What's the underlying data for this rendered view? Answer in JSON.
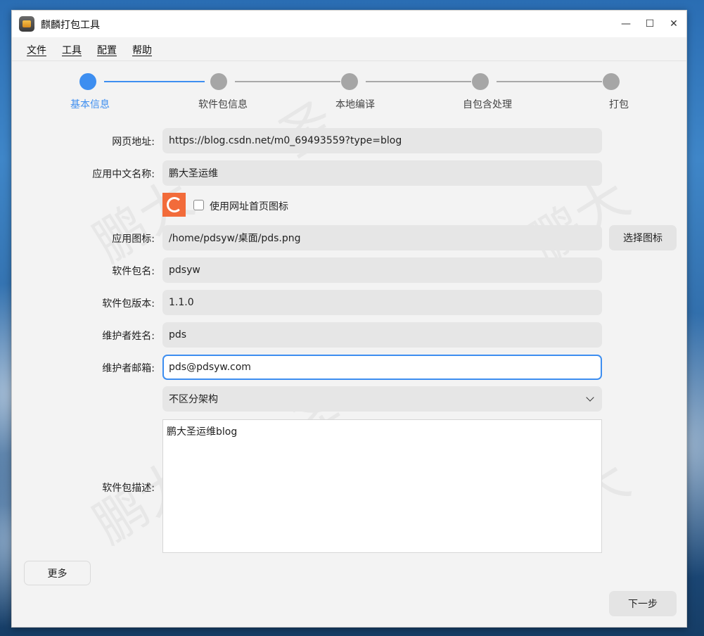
{
  "window": {
    "title": "麒麟打包工具",
    "minimize_glyph": "—",
    "maximize_glyph": "☐",
    "close_glyph": "✕"
  },
  "menu": [
    "文件",
    "工具",
    "配置",
    "帮助"
  ],
  "steps": [
    {
      "label": "基本信息",
      "active": true
    },
    {
      "label": "软件包信息",
      "active": false
    },
    {
      "label": "本地编译",
      "active": false
    },
    {
      "label": "自包含处理",
      "active": false
    },
    {
      "label": "打包",
      "active": false
    }
  ],
  "form": {
    "url_label": "网页地址:",
    "url_value": "https://blog.csdn.net/m0_69493559?type=blog",
    "cn_name_label": "应用中文名称:",
    "cn_name_value": "鹏大圣运维",
    "use_site_icon_label": "使用网址首页图标",
    "use_site_icon_checked": false,
    "icon_label": "应用图标:",
    "icon_value": "/home/pdsyw/桌面/pds.png",
    "choose_icon_button": "选择图标",
    "pkg_name_label": "软件包名:",
    "pkg_name_value": "pdsyw",
    "pkg_version_label": "软件包版本:",
    "pkg_version_value": "1.1.0",
    "maintainer_name_label": "维护者姓名:",
    "maintainer_name_value": "pds",
    "maintainer_email_label": "维护者邮箱:",
    "maintainer_email_value": "pds@pdsyw.com",
    "arch_selected": "不区分架构",
    "desc_label": "软件包描述:",
    "desc_value": "鹏大圣运维blog"
  },
  "buttons": {
    "more": "更多",
    "next": "下一步"
  },
  "watermark_text": [
    "鹏",
    "大",
    "圣"
  ],
  "colors": {
    "accent": "#3d8ef0",
    "step_inactive": "#a6a6a6",
    "csdn_icon": "#f26b3a"
  }
}
